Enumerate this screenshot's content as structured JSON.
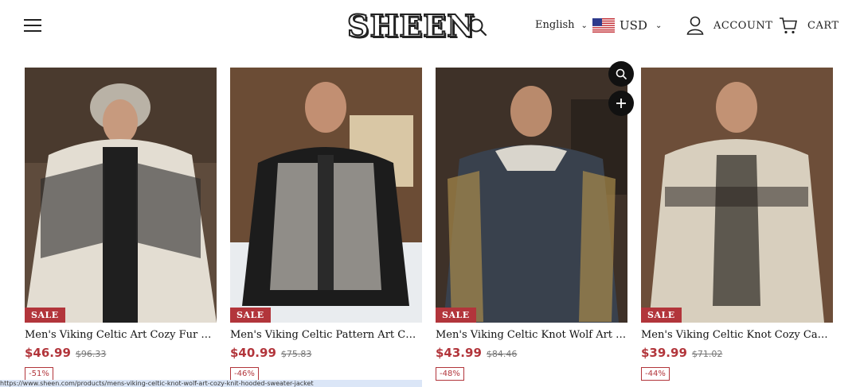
{
  "header": {
    "logo_text": "SHEEN",
    "language": "English",
    "currency": "USD",
    "account_label": "ACCOUNT",
    "cart_label": "CART"
  },
  "products": [
    {
      "title": "Men's Viking Celtic Art Cozy Fur Collar...",
      "price": "$46.99",
      "old_price": "$96.33",
      "discount": "-51%",
      "badge": "SALE"
    },
    {
      "title": "Men's Viking Celtic Pattern Art Cozy H...",
      "price": "$40.99",
      "old_price": "$75.83",
      "discount": "-46%",
      "badge": "SALE"
    },
    {
      "title": "Men's Viking Celtic Knot Wolf Art Cozy ...",
      "price": "$43.99",
      "old_price": "$84.46",
      "discount": "-48%",
      "badge": "SALE"
    },
    {
      "title": "Men's Viking Celtic Knot Cozy Casual H...",
      "price": "$39.99",
      "old_price": "$71.02",
      "discount": "-44%",
      "badge": "SALE"
    }
  ],
  "colors": {
    "accent": "#b2353b",
    "text": "#1a1a1a",
    "button": "#111111"
  },
  "status_bar_text": "https://www.sheen.com/products/mens-viking-celtic-knot-wolf-art-cozy-knit-hooded-sweater-jacket"
}
